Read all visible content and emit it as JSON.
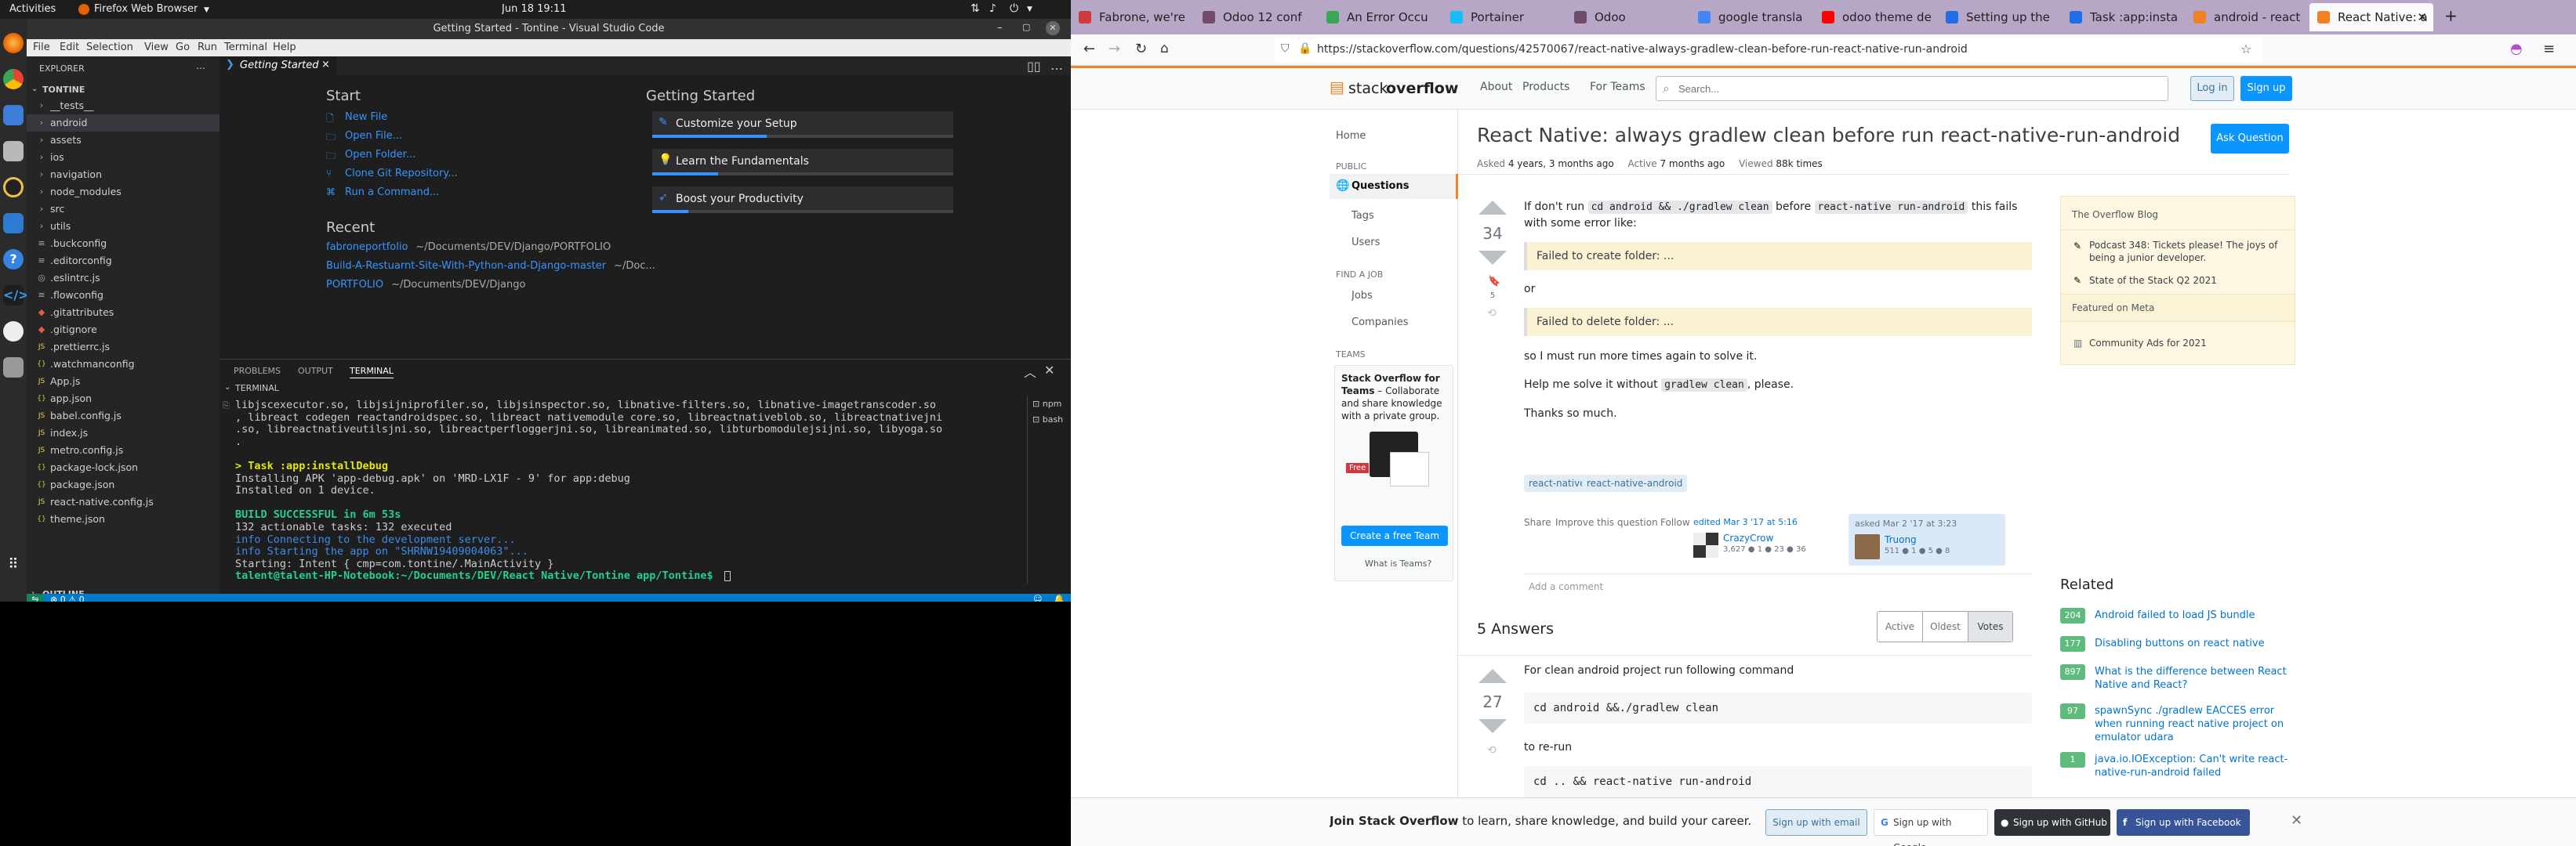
{
  "topbar": {
    "activities": "Activities",
    "app": "Firefox Web Browser",
    "clock": "Jun 18  19:11"
  },
  "vscode": {
    "title": "Getting Started - Tontine - Visual Studio Code",
    "menu": [
      "File",
      "Edit",
      "Selection",
      "View",
      "Go",
      "Run",
      "Terminal",
      "Help"
    ],
    "explorer_label": "EXPLORER",
    "folder": "TONTINE",
    "outline": "OUTLINE",
    "tree": [
      {
        "label": "__tests__",
        "icon": "›"
      },
      {
        "label": "android",
        "icon": "›"
      },
      {
        "label": "assets",
        "icon": "›"
      },
      {
        "label": "ios",
        "icon": "›"
      },
      {
        "label": "navigation",
        "icon": "›"
      },
      {
        "label": "node_modules",
        "icon": "›"
      },
      {
        "label": "src",
        "icon": "›"
      },
      {
        "label": "utils",
        "icon": "›"
      },
      {
        "label": ".buckconfig",
        "icon": "≡"
      },
      {
        "label": ".editorconfig",
        "icon": "≡"
      },
      {
        "label": ".eslintrc.js",
        "icon": "◎"
      },
      {
        "label": ".flowconfig",
        "icon": "≡"
      },
      {
        "label": ".gitattributes",
        "icon": "◆"
      },
      {
        "label": ".gitignore",
        "icon": "◆"
      },
      {
        "label": ".prettierrc.js",
        "icon": "JS"
      },
      {
        "label": ".watchmanconfig",
        "icon": "{}"
      },
      {
        "label": "App.js",
        "icon": "JS"
      },
      {
        "label": "app.json",
        "icon": "{}"
      },
      {
        "label": "babel.config.js",
        "icon": "JS"
      },
      {
        "label": "index.js",
        "icon": "JS"
      },
      {
        "label": "metro.config.js",
        "icon": "JS"
      },
      {
        "label": "package-lock.json",
        "icon": "{}"
      },
      {
        "label": "package.json",
        "icon": "{}"
      },
      {
        "label": "react-native.config.js",
        "icon": "JS"
      },
      {
        "label": "theme.json",
        "icon": "{}"
      }
    ],
    "tab": "Getting Started",
    "start_heading": "Start",
    "start_links": [
      "New File",
      "Open File...",
      "Open Folder...",
      "Clone Git Repository...",
      "Run a Command..."
    ],
    "recent_heading": "Recent",
    "recent": [
      {
        "name": "fabroneportfolio",
        "path": "~/Documents/DEV/Django/PORTFOLIO"
      },
      {
        "name": "Build-A-Restuarnt-Site-With-Python-and-Django-master",
        "path": "~/Doc..."
      },
      {
        "name": "PORTFOLIO",
        "path": "~/Documents/DEV/Django"
      }
    ],
    "gs_heading": "Getting Started",
    "gs_cards": [
      "Customize your Setup",
      "Learn the Fundamentals",
      "Boost your Productivity"
    ],
    "panel_tabs": [
      "PROBLEMS",
      "OUTPUT",
      "TERMINAL"
    ],
    "terminal_label": "TERMINAL",
    "terminal_lines": [
      " libjscexecutor.so, libjsijniprofiler.so, libjsinspector.so, libnative-filters.so, libnative-imagetranscoder.so",
      ", libreact codegen reactandroidspec.so, libreact nativemodule core.so, libreactnativeblob.so, libreactnativejni",
      ".so, libreactnativeutilsjni.so, libreactperfloggerjni.so, libreanimated.so, libturbomodulejsijni.so, libyoga.so",
      ".",
      "",
      "> Task :app:installDebug",
      "Installing APK 'app-debug.apk' on 'MRD-LX1F - 9' for app:debug",
      "Installed on 1 device.",
      "",
      "BUILD SUCCESSFUL in 6m 53s",
      "132 actionable tasks: 132 executed",
      "info Connecting to the development server...",
      "info Starting the app on \"SHRNW19409004063\"...",
      "Starting: Intent { cmp=com.tontine/.MainActivity }",
      "talent@talent-HP-Notebook:~/Documents/DEV/React Native/Tontine app/Tontine$ "
    ],
    "shells": [
      "npm",
      "bash"
    ],
    "status": "⊗ 0 ⚠ 0"
  },
  "firefox": {
    "tabs": [
      "Fabrone, we're",
      "Odoo 12 conf",
      "An Error Occu",
      "Portainer",
      "Odoo",
      "google transla",
      "odoo theme de",
      "Setting up the",
      "Task :app:insta",
      "android - react",
      "React Native: a"
    ],
    "url": "https://stackoverflow.com/questions/42570067/react-native-always-gradlew-clean-before-run-react-native-run-android"
  },
  "so": {
    "logo_a": "stack",
    "logo_b": "overflow",
    "nav": [
      "About",
      "Products",
      "For Teams"
    ],
    "search_placeholder": "Search...",
    "login": "Log in",
    "signup": "Sign up",
    "left_nav": {
      "home": "Home",
      "public": "PUBLIC",
      "questions": "Questions",
      "tags": "Tags",
      "users": "Users",
      "find_job": "FIND A JOB",
      "jobs": "Jobs",
      "companies": "Companies",
      "teams": "TEAMS"
    },
    "teams_box": {
      "title": "Stack Overflow for Teams",
      "desc": " – Collaborate and share knowledge with a private group.",
      "free": "Free",
      "button": "Create a free Team",
      "link": "What is Teams?"
    },
    "question": {
      "title": "React Native: always gradlew clean before run react-native-run-android",
      "ask": "Ask Question",
      "asked_label": "Asked",
      "asked": "4 years, 3 months ago",
      "active_label": "Active",
      "active": "7 months ago",
      "viewed_label": "Viewed",
      "viewed": "88k times",
      "votes": "34",
      "bookmarks": "5",
      "p1a": "If don't run ",
      "code1": "cd android && ./gradlew clean",
      "p1b": " before ",
      "code2": "react-native run-android",
      "p1c": " this fails with some error like:",
      "quote1": "Failed to create folder: ...",
      "or": "or",
      "quote2": "Failed to delete folder: ...",
      "p2": "so I must run more times again to solve it.",
      "p3a": "Help me solve it without ",
      "code3": "gradlew clean",
      "p3b": ", please.",
      "p4": "Thanks so much.",
      "tags": [
        "react-native",
        "react-native-android"
      ],
      "actions": [
        "Share",
        "Improve this question",
        "Follow"
      ],
      "edited": "edited Mar 3 '17 at 5:16",
      "editor": "CrazyCrow",
      "editor_rep": "3,627 ● 1 ● 23 ● 36",
      "asked_card": "asked Mar 2 '17 at 3:23",
      "asker": "Truong",
      "asker_rep": "511 ● 1 ● 5 ● 8",
      "add_comment": "Add a comment"
    },
    "answers": {
      "heading": "5 Answers",
      "sort": [
        "Active",
        "Oldest",
        "Votes"
      ],
      "votes": "27",
      "p1": "For clean android project run following command",
      "code1": "cd android &&./gradlew clean",
      "p2": "to re-run",
      "code2": "cd .. && react-native run-android"
    },
    "blog": {
      "heading": "The Overflow Blog",
      "items": [
        "Podcast 348: Tickets please! The joys of being a junior developer.",
        "State of the Stack Q2 2021"
      ],
      "meta_heading": "Featured on Meta",
      "meta_items": [
        "Community Ads for 2021"
      ]
    },
    "related": {
      "heading": "Related",
      "items": [
        {
          "count": "204",
          "title": "Android failed to load JS bundle"
        },
        {
          "count": "177",
          "title": "Disabling buttons on react native"
        },
        {
          "count": "897",
          "title": "What is the difference between React Native and React?"
        },
        {
          "count": "97",
          "title": "spawnSync ./gradlew EACCES error when running react native project on emulator udara"
        },
        {
          "count": "1",
          "title": "java.io.IOException: Can't write react-native-run-android failed"
        }
      ]
    },
    "banner": {
      "bold": "Join Stack Overflow",
      "rest": " to learn, share knowledge, and build your career.",
      "email": "Sign up with email",
      "google": "Sign up with Google",
      "github": "Sign up with GitHub",
      "facebook": "Sign up with Facebook"
    }
  }
}
